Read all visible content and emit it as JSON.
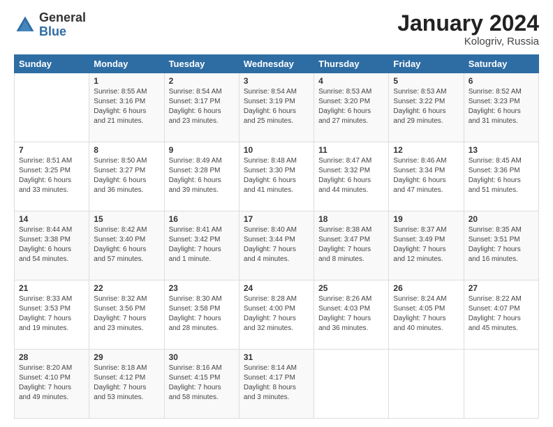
{
  "header": {
    "logo_general": "General",
    "logo_blue": "Blue",
    "month_year": "January 2024",
    "location": "Kologriv, Russia"
  },
  "columns": [
    "Sunday",
    "Monday",
    "Tuesday",
    "Wednesday",
    "Thursday",
    "Friday",
    "Saturday"
  ],
  "rows": [
    [
      {
        "day": "",
        "content": ""
      },
      {
        "day": "1",
        "content": "Sunrise: 8:55 AM\nSunset: 3:16 PM\nDaylight: 6 hours\nand 21 minutes."
      },
      {
        "day": "2",
        "content": "Sunrise: 8:54 AM\nSunset: 3:17 PM\nDaylight: 6 hours\nand 23 minutes."
      },
      {
        "day": "3",
        "content": "Sunrise: 8:54 AM\nSunset: 3:19 PM\nDaylight: 6 hours\nand 25 minutes."
      },
      {
        "day": "4",
        "content": "Sunrise: 8:53 AM\nSunset: 3:20 PM\nDaylight: 6 hours\nand 27 minutes."
      },
      {
        "day": "5",
        "content": "Sunrise: 8:53 AM\nSunset: 3:22 PM\nDaylight: 6 hours\nand 29 minutes."
      },
      {
        "day": "6",
        "content": "Sunrise: 8:52 AM\nSunset: 3:23 PM\nDaylight: 6 hours\nand 31 minutes."
      }
    ],
    [
      {
        "day": "7",
        "content": "Sunrise: 8:51 AM\nSunset: 3:25 PM\nDaylight: 6 hours\nand 33 minutes."
      },
      {
        "day": "8",
        "content": "Sunrise: 8:50 AM\nSunset: 3:27 PM\nDaylight: 6 hours\nand 36 minutes."
      },
      {
        "day": "9",
        "content": "Sunrise: 8:49 AM\nSunset: 3:28 PM\nDaylight: 6 hours\nand 39 minutes."
      },
      {
        "day": "10",
        "content": "Sunrise: 8:48 AM\nSunset: 3:30 PM\nDaylight: 6 hours\nand 41 minutes."
      },
      {
        "day": "11",
        "content": "Sunrise: 8:47 AM\nSunset: 3:32 PM\nDaylight: 6 hours\nand 44 minutes."
      },
      {
        "day": "12",
        "content": "Sunrise: 8:46 AM\nSunset: 3:34 PM\nDaylight: 6 hours\nand 47 minutes."
      },
      {
        "day": "13",
        "content": "Sunrise: 8:45 AM\nSunset: 3:36 PM\nDaylight: 6 hours\nand 51 minutes."
      }
    ],
    [
      {
        "day": "14",
        "content": "Sunrise: 8:44 AM\nSunset: 3:38 PM\nDaylight: 6 hours\nand 54 minutes."
      },
      {
        "day": "15",
        "content": "Sunrise: 8:42 AM\nSunset: 3:40 PM\nDaylight: 6 hours\nand 57 minutes."
      },
      {
        "day": "16",
        "content": "Sunrise: 8:41 AM\nSunset: 3:42 PM\nDaylight: 7 hours\nand 1 minute."
      },
      {
        "day": "17",
        "content": "Sunrise: 8:40 AM\nSunset: 3:44 PM\nDaylight: 7 hours\nand 4 minutes."
      },
      {
        "day": "18",
        "content": "Sunrise: 8:38 AM\nSunset: 3:47 PM\nDaylight: 7 hours\nand 8 minutes."
      },
      {
        "day": "19",
        "content": "Sunrise: 8:37 AM\nSunset: 3:49 PM\nDaylight: 7 hours\nand 12 minutes."
      },
      {
        "day": "20",
        "content": "Sunrise: 8:35 AM\nSunset: 3:51 PM\nDaylight: 7 hours\nand 16 minutes."
      }
    ],
    [
      {
        "day": "21",
        "content": "Sunrise: 8:33 AM\nSunset: 3:53 PM\nDaylight: 7 hours\nand 19 minutes."
      },
      {
        "day": "22",
        "content": "Sunrise: 8:32 AM\nSunset: 3:56 PM\nDaylight: 7 hours\nand 23 minutes."
      },
      {
        "day": "23",
        "content": "Sunrise: 8:30 AM\nSunset: 3:58 PM\nDaylight: 7 hours\nand 28 minutes."
      },
      {
        "day": "24",
        "content": "Sunrise: 8:28 AM\nSunset: 4:00 PM\nDaylight: 7 hours\nand 32 minutes."
      },
      {
        "day": "25",
        "content": "Sunrise: 8:26 AM\nSunset: 4:03 PM\nDaylight: 7 hours\nand 36 minutes."
      },
      {
        "day": "26",
        "content": "Sunrise: 8:24 AM\nSunset: 4:05 PM\nDaylight: 7 hours\nand 40 minutes."
      },
      {
        "day": "27",
        "content": "Sunrise: 8:22 AM\nSunset: 4:07 PM\nDaylight: 7 hours\nand 45 minutes."
      }
    ],
    [
      {
        "day": "28",
        "content": "Sunrise: 8:20 AM\nSunset: 4:10 PM\nDaylight: 7 hours\nand 49 minutes."
      },
      {
        "day": "29",
        "content": "Sunrise: 8:18 AM\nSunset: 4:12 PM\nDaylight: 7 hours\nand 53 minutes."
      },
      {
        "day": "30",
        "content": "Sunrise: 8:16 AM\nSunset: 4:15 PM\nDaylight: 7 hours\nand 58 minutes."
      },
      {
        "day": "31",
        "content": "Sunrise: 8:14 AM\nSunset: 4:17 PM\nDaylight: 8 hours\nand 3 minutes."
      },
      {
        "day": "",
        "content": ""
      },
      {
        "day": "",
        "content": ""
      },
      {
        "day": "",
        "content": ""
      }
    ]
  ]
}
